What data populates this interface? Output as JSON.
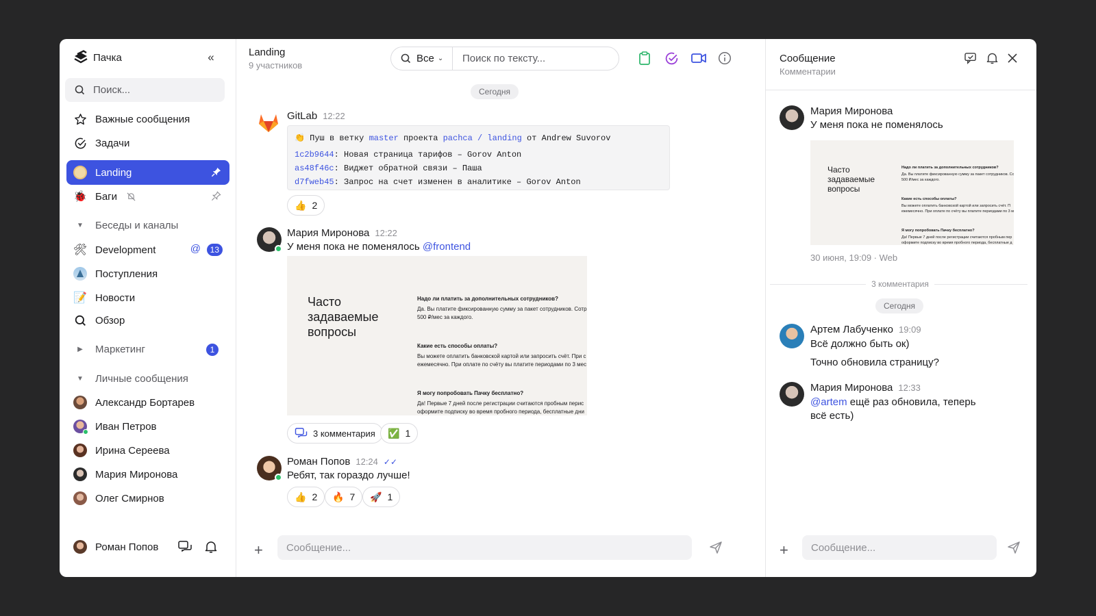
{
  "app": {
    "name": "Пачка"
  },
  "sidebar": {
    "search_placeholder": "Поиск...",
    "important": "Важные сообщения",
    "tasks": "Задачи",
    "pinned": [
      {
        "label": "Landing",
        "active": true
      },
      {
        "label": "Баги",
        "active": false
      }
    ],
    "section_channels": "Беседы и каналы",
    "channels": [
      {
        "label": "Development",
        "mention": "@",
        "badge": "13"
      },
      {
        "label": "Поступления"
      },
      {
        "label": "Новости"
      },
      {
        "label": "Обзор"
      }
    ],
    "marketing": {
      "label": "Маркетинг",
      "badge": "1"
    },
    "section_dm": "Личные сообщения",
    "dms": [
      {
        "label": "Александр Бортарев"
      },
      {
        "label": "Иван Петров"
      },
      {
        "label": "Ирина Сереева"
      },
      {
        "label": "Мария Миронова"
      },
      {
        "label": "Олег Смирнов"
      }
    ],
    "current_user": "Роман Попов"
  },
  "chat": {
    "title": "Landing",
    "subtitle": "9 участников",
    "filter": "Все",
    "search_placeholder": "Поиск по тексту...",
    "date_pill": "Сегодня",
    "gitlab": {
      "name": "GitLab",
      "time": "12:22",
      "push_prefix": "👏 Пуш в ветку",
      "branch": "master",
      "project_prefix": "проекта",
      "project": "pachca / landing",
      "author_prefix": "от Andrew Suvorov",
      "commits": [
        {
          "hash": "1c2b9644",
          "text": ": Новая страница тарифов – Gorov Anton"
        },
        {
          "hash": "as48f46c",
          "text": ": Виджет обратной связи – Паша"
        },
        {
          "hash": "d7fweb45",
          "text": ": Запрос на счет изменен в аналитике – Gorov Anton"
        }
      ],
      "reaction": {
        "emoji": "👍",
        "count": "2"
      }
    },
    "maria": {
      "name": "Мария Миронова",
      "time": "12:22",
      "text": "У меня пока не поменялось",
      "mention": "@frontend",
      "faq_title": "Часто задаваемые вопросы",
      "faq": [
        {
          "q": "Надо ли платить за дополнительных сотрудников?",
          "a": "Да. Вы платите фиксированную сумму за пакет сотрудников. Сотр 500 ₽/мес за каждого."
        },
        {
          "q": "Какие есть способы оплаты?",
          "a": "Вы можете оплатить банковской картой или запросить счёт. При с ежемесячно. При оплате по счёту вы платите периодами по 3 мес"
        },
        {
          "q": "Я могу попробовать Пачку бесплатно?",
          "a": "Да! Первые 7 дней после регистрации считаются пробным перис оформите подписку во время пробного периода, бесплатные дни"
        }
      ],
      "comments_btn": "3 комментария",
      "reaction": {
        "emoji": "✅",
        "count": "1"
      }
    },
    "roman": {
      "name": "Роман Попов",
      "time": "12:24",
      "text": "Ребят, так гораздо лучше!",
      "reactions": [
        {
          "emoji": "👍",
          "count": "2"
        },
        {
          "emoji": "🔥",
          "count": "7"
        },
        {
          "emoji": "🚀",
          "count": "1"
        }
      ]
    },
    "input_placeholder": "Сообщение..."
  },
  "thread": {
    "title": "Сообщение",
    "subtitle": "Комментарии",
    "root": {
      "name": "Мария Миронова",
      "text": "У меня пока не поменялось",
      "meta": "30 июня, 19:09 · Web",
      "faq_title": "Часто задаваемые вопросы",
      "faq": [
        {
          "q": "Надо ли платить за дополнительных сотрудников?",
          "a": "Да. Вы платите фиксированную сумму за пакет сотрудников. Со 500 ₽/мес за каждого."
        },
        {
          "q": "Какие есть способы оплаты?",
          "a": "Вы можете оплатить банковской картой или запросить счёт. П ежемесячно. При оплате по счёту вы платите периодами по 3 м"
        },
        {
          "q": "Я могу попробовать Пачку бесплатно?",
          "a": "Да! Первые 7 дней после регистрации считаются пробным пер оформите подписку во время пробного периода, бесплатные д"
        }
      ]
    },
    "count_label": "3 комментария",
    "date_pill": "Сегодня",
    "comments": [
      {
        "name": "Артем Лабученко",
        "time": "19:09",
        "lines": [
          "Всё должно быть ок)",
          "Точно обновила страницу?"
        ]
      },
      {
        "name": "Мария Миронова",
        "time": "12:33",
        "mention": "@artem",
        "text": " ещё раз обновила, теперь всё есть)"
      }
    ],
    "input_placeholder": "Сообщение..."
  },
  "colors": {
    "accent": "#3d53e0",
    "online": "#2bc06b",
    "background": "#262627"
  }
}
